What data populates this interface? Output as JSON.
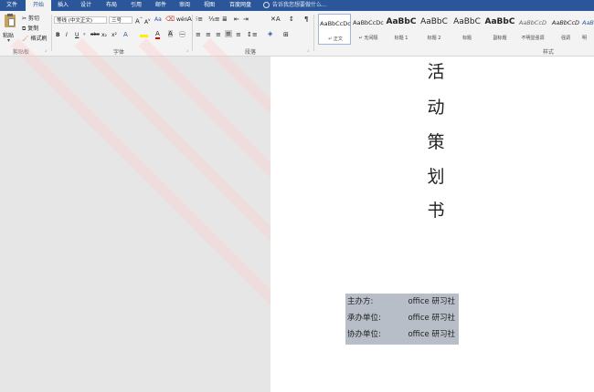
{
  "tabs": [
    "文件",
    "开始",
    "插入",
    "设计",
    "布局",
    "引用",
    "邮件",
    "审阅",
    "视图",
    "百度网盘"
  ],
  "active_tab": "开始",
  "tell_me": "告诉我您想要做什么...",
  "clipboard": {
    "paste": "粘贴",
    "cut": "剪切",
    "copy": "复制",
    "format_painter": "格式刷",
    "label": "剪贴板"
  },
  "font": {
    "name": "等线 (中文正文)",
    "size": "三号",
    "bold": "B",
    "italic": "I",
    "underline": "U",
    "strike": "abc",
    "subscript": "x₂",
    "superscript": "x²",
    "grow": "A",
    "shrink": "A",
    "color_a": "A",
    "label": "字体"
  },
  "paragraph": {
    "label": "段落"
  },
  "styles": {
    "label": "样式",
    "items": [
      {
        "sample": "AaBbCcDc",
        "name": "↵ 正文"
      },
      {
        "sample": "AaBbCcDc",
        "name": "↵ 无间隔"
      },
      {
        "sample": "AaBbC",
        "name": "标题 1"
      },
      {
        "sample": "AaBbC",
        "name": "标题 2"
      },
      {
        "sample": "AaBbC",
        "name": "标题"
      },
      {
        "sample": "AaBbC",
        "name": "副标题"
      },
      {
        "sample": "AaBbCcD",
        "name": "不明显强调"
      },
      {
        "sample": "AaBbCcD",
        "name": "强调"
      },
      {
        "sample": "AaBb",
        "name": "明"
      }
    ]
  },
  "document": {
    "title_chars": [
      "活",
      "动",
      "策",
      "划",
      "书"
    ],
    "info": [
      {
        "label": "主办方:",
        "value": "office 研习社"
      },
      {
        "label": "承办单位:",
        "value": "office 研习社"
      },
      {
        "label": "协办单位:",
        "value": "office 研习社"
      }
    ]
  },
  "colors": {
    "title_bar": "#2b579a",
    "ribbon": "#f3f3f3",
    "highlight": "#b7bec8"
  }
}
